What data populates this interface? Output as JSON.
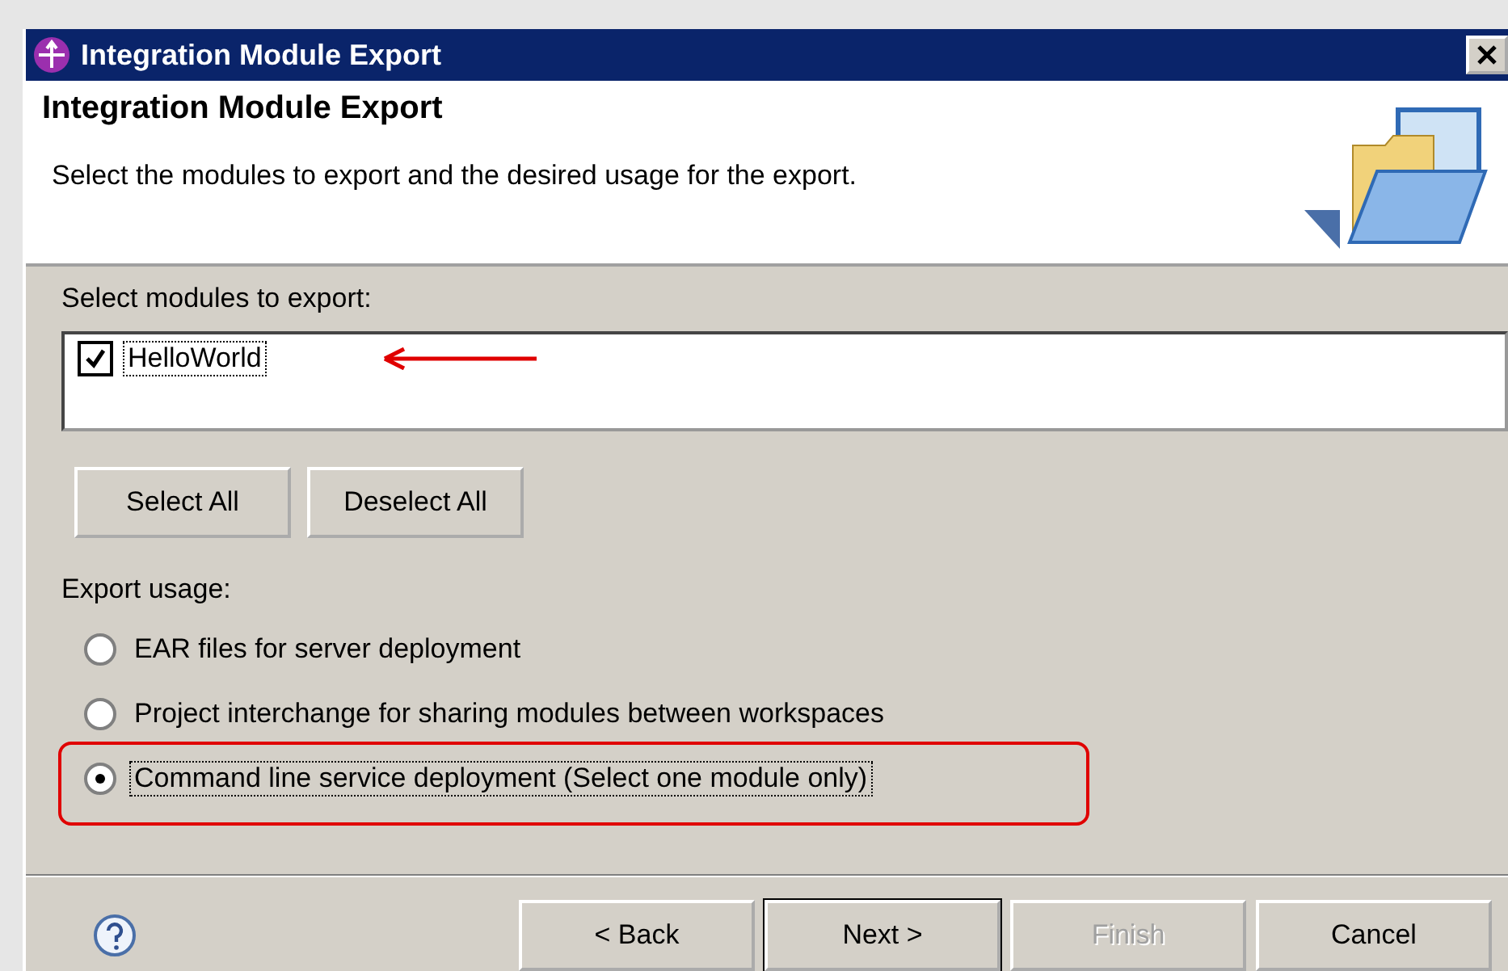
{
  "window": {
    "title": "Integration Module Export"
  },
  "header": {
    "title": "Integration Module Export",
    "description": "Select the modules to export and the desired usage for the export."
  },
  "modules": {
    "label": "Select modules to export:",
    "items": [
      {
        "name": "HelloWorld",
        "checked": true,
        "annotated": true
      }
    ]
  },
  "selection_buttons": [
    {
      "label": "Select All"
    },
    {
      "label": "Deselect All"
    }
  ],
  "usage": {
    "label": "Export usage:",
    "options": [
      {
        "label": "EAR files for server deployment",
        "selected": false,
        "highlighted": false
      },
      {
        "label": "Project interchange for sharing modules between workspaces",
        "selected": false,
        "highlighted": false
      },
      {
        "label": "Command line service deployment (Select one module only)",
        "selected": true,
        "highlighted": true
      }
    ]
  },
  "footer_buttons": [
    {
      "label": "< Back",
      "disabled": false,
      "default": false
    },
    {
      "label": "Next >",
      "disabled": false,
      "default": true
    },
    {
      "label": "Finish",
      "disabled": true,
      "default": false
    },
    {
      "label": "Cancel",
      "disabled": false,
      "default": false
    }
  ]
}
